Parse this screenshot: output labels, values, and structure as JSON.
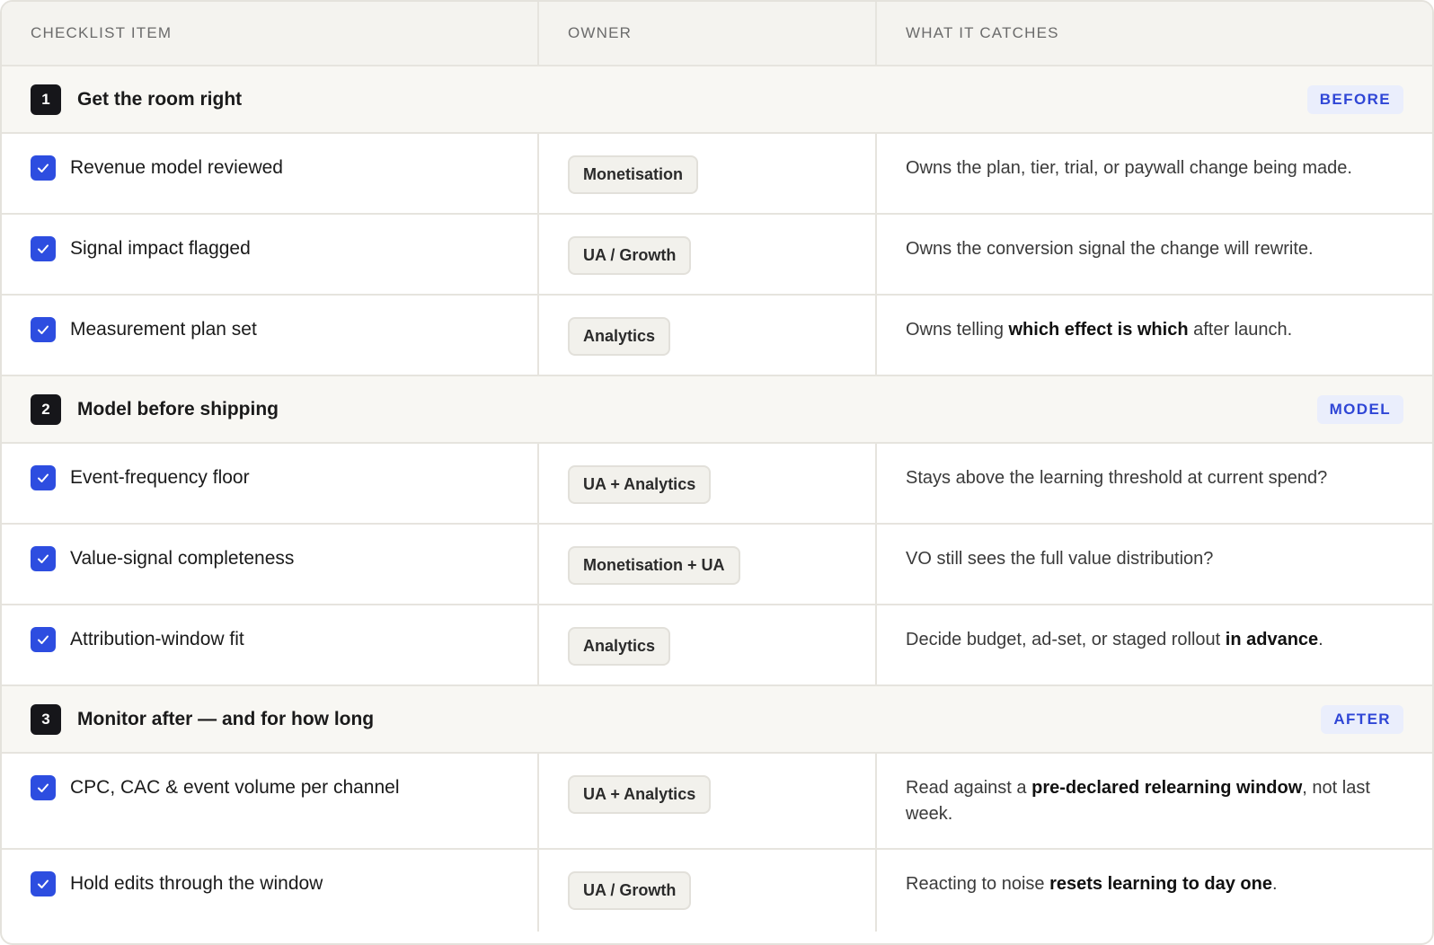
{
  "header": {
    "col_item": "CHECKLIST ITEM",
    "col_owner": "OWNER",
    "col_catches": "WHAT IT CATCHES"
  },
  "sections": [
    {
      "number": "1",
      "title": "Get the room right",
      "phase": "BEFORE",
      "items": [
        {
          "label": "Revenue model reviewed",
          "checked": true,
          "owner": "Monetisation",
          "catch_parts": [
            "Owns the plan, tier, trial, or paywall change being made.",
            "",
            ""
          ]
        },
        {
          "label": "Signal impact flagged",
          "checked": true,
          "owner": "UA / Growth",
          "catch_parts": [
            "Owns the conversion signal the change will rewrite.",
            "",
            ""
          ]
        },
        {
          "label": "Measurement plan set",
          "checked": true,
          "owner": "Analytics",
          "catch_parts": [
            "Owns telling ",
            "which effect is which",
            " after launch."
          ]
        }
      ]
    },
    {
      "number": "2",
      "title": "Model before shipping",
      "phase": "MODEL",
      "items": [
        {
          "label": "Event-frequency floor",
          "checked": true,
          "owner": "UA + Analytics",
          "catch_parts": [
            "Stays above the learning threshold at current spend?",
            "",
            ""
          ]
        },
        {
          "label": "Value-signal completeness",
          "checked": true,
          "owner": "Monetisation + UA",
          "catch_parts": [
            "VO still sees the full value distribution?",
            "",
            ""
          ]
        },
        {
          "label": "Attribution-window fit",
          "checked": true,
          "owner": "Analytics",
          "catch_parts": [
            "Decide budget, ad-set, or staged rollout ",
            "in advance",
            "."
          ]
        }
      ]
    },
    {
      "number": "3",
      "title": "Monitor after — and for how long",
      "phase": "AFTER",
      "items": [
        {
          "label": "CPC, CAC & event volume per channel",
          "checked": true,
          "owner": "UA + Analytics",
          "catch_parts": [
            "Read against a ",
            "pre-declared relearning window",
            ", not last week."
          ]
        },
        {
          "label": "Hold edits through the window",
          "checked": true,
          "owner": "UA / Growth",
          "catch_parts": [
            "Reacting to noise ",
            "resets learning to day one",
            "."
          ]
        }
      ]
    }
  ],
  "colors": {
    "accent": "#2d4de0",
    "phase_text": "#2f46d6",
    "phase_bg": "#eaeefc",
    "header_bg": "#f4f3ef",
    "section_bg": "#f8f7f3"
  },
  "icons": {
    "check": "checkmark-icon"
  }
}
